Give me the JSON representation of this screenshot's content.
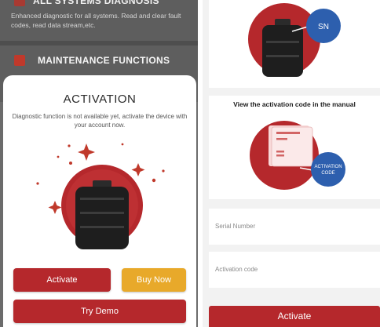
{
  "background": {
    "row1_title": "ALL SYSTEMS DIAGNOSIS",
    "row1_desc": "Enhanced diagnostic for all systems. Read and clear fault codes, read data stream,etc.",
    "row2_title": "MAINTENANCE FUNCTIONS"
  },
  "dialog": {
    "title": "ACTIVATION",
    "message": "Diagnostic function is not available yet, activate the device with your account now.",
    "activate_label": "Activate",
    "buynow_label": "Buy Now",
    "trydemo_label": "Try Demo"
  },
  "right": {
    "sn_badge": "SN",
    "manual_title": "View the activation code in the manual",
    "code_badge_line1": "ACTIVATION",
    "code_badge_line2": "CODE",
    "serial_placeholder": "Serial Number",
    "code_placeholder": "Activation code",
    "activate_label": "Activate"
  },
  "colors": {
    "primary_red": "#b5282c",
    "accent_yellow": "#e8a92a",
    "badge_blue": "#2d5fae"
  }
}
